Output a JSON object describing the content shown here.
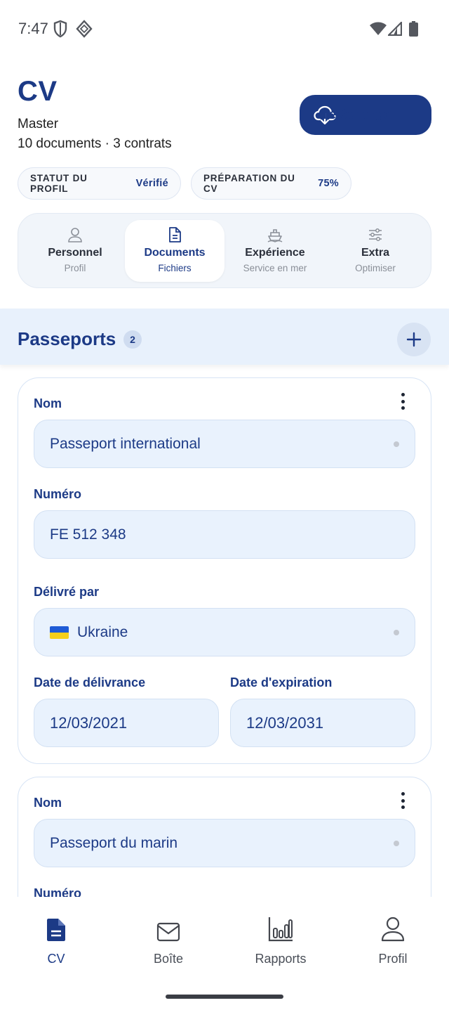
{
  "status_bar": {
    "time": "7:47"
  },
  "header": {
    "title": "CV",
    "subtitle": "Master",
    "summary": "10 documents · 3 contrats",
    "download_label": "Télécharger"
  },
  "chips": [
    {
      "label": "STATUT DU PROFIL",
      "value": "Vérifié"
    },
    {
      "label": "PRÉPARATION DU CV",
      "value": "75%"
    }
  ],
  "tabs": [
    {
      "label": "Personnel",
      "sub": "Profil",
      "icon": "person-icon"
    },
    {
      "label": "Documents",
      "sub": "Fichiers",
      "icon": "document-icon",
      "active": true
    },
    {
      "label": "Expérience",
      "sub": "Service en mer",
      "icon": "ship-icon"
    },
    {
      "label": "Extra",
      "sub": "Optimiser",
      "icon": "sliders-icon"
    }
  ],
  "section": {
    "title": "Passeports",
    "count": "2"
  },
  "cards": [
    {
      "name_label": "Nom",
      "name_value": "Passeport international",
      "number_label": "Numéro",
      "number_value": "FE 512 348",
      "issuer_label": "Délivré par",
      "issuer_value": "Ukraine",
      "issue_date_label": "Date de délivrance",
      "issue_date_value": "12/03/2021",
      "expiry_date_label": "Date d'expiration",
      "expiry_date_value": "12/03/2031"
    },
    {
      "name_label": "Nom",
      "name_value": "Passeport du marin",
      "number_label": "Numéro"
    }
  ],
  "bottom_nav": [
    {
      "label": "CV",
      "icon": "cv-document-icon",
      "active": true
    },
    {
      "label": "Boîte",
      "icon": "mail-icon"
    },
    {
      "label": "Rapports",
      "icon": "bar-chart-icon"
    },
    {
      "label": "Profil",
      "icon": "profile-icon"
    }
  ],
  "colors": {
    "primary": "#1c3a86",
    "field_bg": "#e9f2fd",
    "section_bg": "#e8f1fc"
  }
}
